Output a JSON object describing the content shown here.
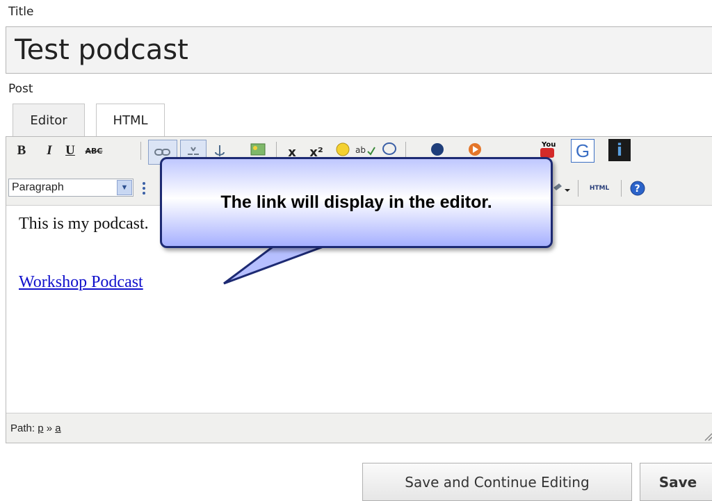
{
  "title_field": {
    "label": "Title",
    "value": "Test podcast"
  },
  "post_field": {
    "label": "Post"
  },
  "tabs": [
    {
      "label": "Editor",
      "active": true
    },
    {
      "label": "HTML",
      "active": false
    }
  ],
  "toolbar": {
    "bold": "B",
    "italic": "I",
    "underline": "U",
    "strikethrough": "ABC",
    "format_select_value": "Paragraph",
    "html_button": "HTML",
    "subscript": "x",
    "superscript": "x²",
    "youtube": "You",
    "google": "G",
    "info": "i"
  },
  "content": {
    "paragraph": "This is my podcast.",
    "link_text": "Workshop Podcast"
  },
  "statusbar": {
    "path_label": "Path:",
    "path_p": "p",
    "path_sep": "»",
    "path_a": "a"
  },
  "buttons": {
    "save_continue": "Save and Continue Editing",
    "save": "Save"
  },
  "callout": {
    "text": "The link will display in the editor."
  },
  "colors": {
    "link": "#1010cc",
    "callout_border": "#1d2a73",
    "callout_fill": "#bfc7ff"
  }
}
